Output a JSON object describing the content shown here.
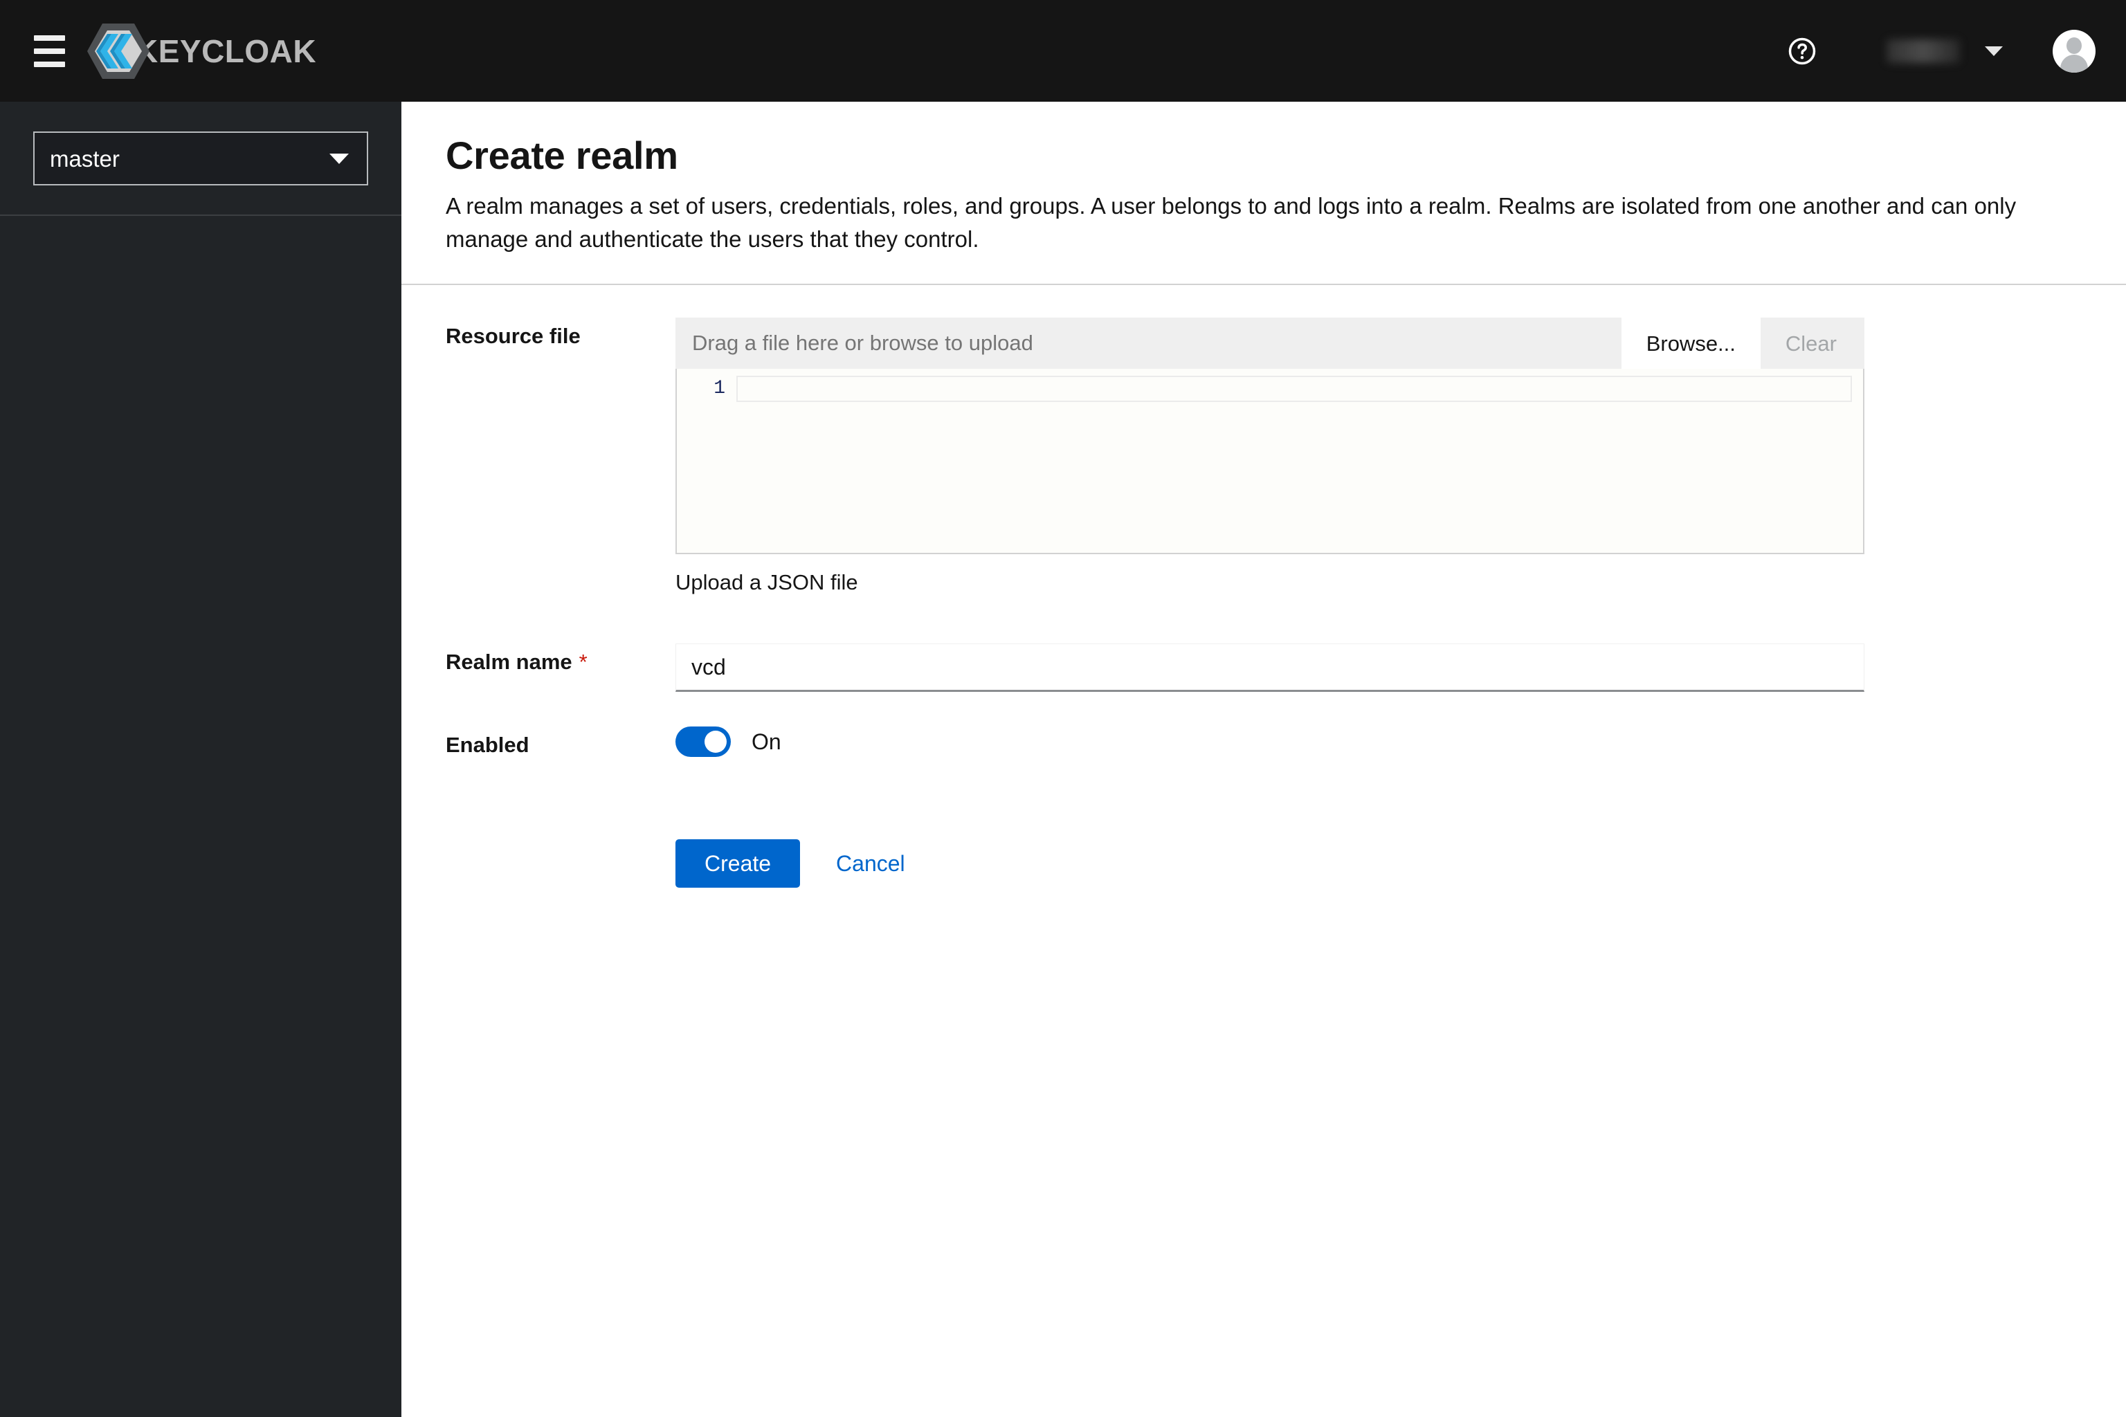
{
  "masthead": {
    "nav_toggle_name": "global-navigation-toggle",
    "brand_wordmark": "KEYCLOAK",
    "brand_logo_icon": "keycloak-logo-icon",
    "help_icon": "help-question-circle-icon",
    "username": "",
    "username_redacted": true,
    "user_caret_icon": "caret-down-icon",
    "avatar_icon": "user-avatar-icon",
    "background_color": "#151515"
  },
  "sidebar": {
    "realm_selector": {
      "selected": "master",
      "caret_icon": "caret-down-icon"
    },
    "background_color": "#212427"
  },
  "page": {
    "title": "Create realm",
    "description": "A realm manages a set of users, credentials, roles, and groups. A user belongs to and logs into a realm. Realms are isolated from one another and can only manage and authenticate the users that they control."
  },
  "form": {
    "resource_file": {
      "label": "Resource file",
      "upload_placeholder": "Drag a file here or browse to upload",
      "filename_value": "",
      "browse_label": "Browse...",
      "clear_label": "Clear",
      "clear_disabled": true,
      "editor": {
        "line_numbers": [
          "1"
        ],
        "lines": [
          ""
        ]
      },
      "helper_text": "Upload a JSON file"
    },
    "realm_name": {
      "label": "Realm name",
      "required_marker": "*",
      "value": "vcd",
      "placeholder": ""
    },
    "enabled": {
      "label": "Enabled",
      "state_label": "On",
      "checked": true
    }
  },
  "actions": {
    "create_label": "Create",
    "cancel_label": "Cancel"
  },
  "colors": {
    "accent_blue": "#0066CC",
    "required_red": "#C9190B",
    "masthead_black": "#151515",
    "sidebar_dark": "#212427",
    "toolbar_grey": "#EFEFEF"
  }
}
